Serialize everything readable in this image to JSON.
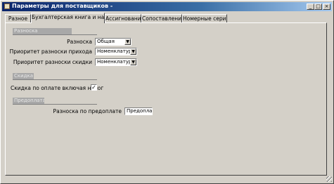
{
  "window": {
    "title": "Параметры для поставщиков -",
    "buttons": {
      "minimize": "_",
      "maximize": "□",
      "close": "×"
    }
  },
  "tabs": [
    {
      "label": "Разное"
    },
    {
      "label": "Бухгалтерская книга и налог",
      "active": true
    },
    {
      "label": "Ассигнования"
    },
    {
      "label": "Сопоставление"
    },
    {
      "label": "Номерные серии"
    }
  ],
  "sections": {
    "posting": {
      "title": "Разноска",
      "fields": [
        {
          "label": "Разноска",
          "value": "Общая"
        },
        {
          "label": "Приоритет разноски прихода",
          "value": "Номенклатура"
        },
        {
          "label": "Приоритет разноски скидки",
          "value": "Номенклатура"
        }
      ]
    },
    "discount": {
      "title": "Скидка",
      "checkbox_label": "Скидка по оплате включая налог",
      "checked": true,
      "check_mark": "✓"
    },
    "prepayment": {
      "title": "Предоплата",
      "field_label": "Разноска по предоплате",
      "field_value": "Предоплата"
    }
  }
}
